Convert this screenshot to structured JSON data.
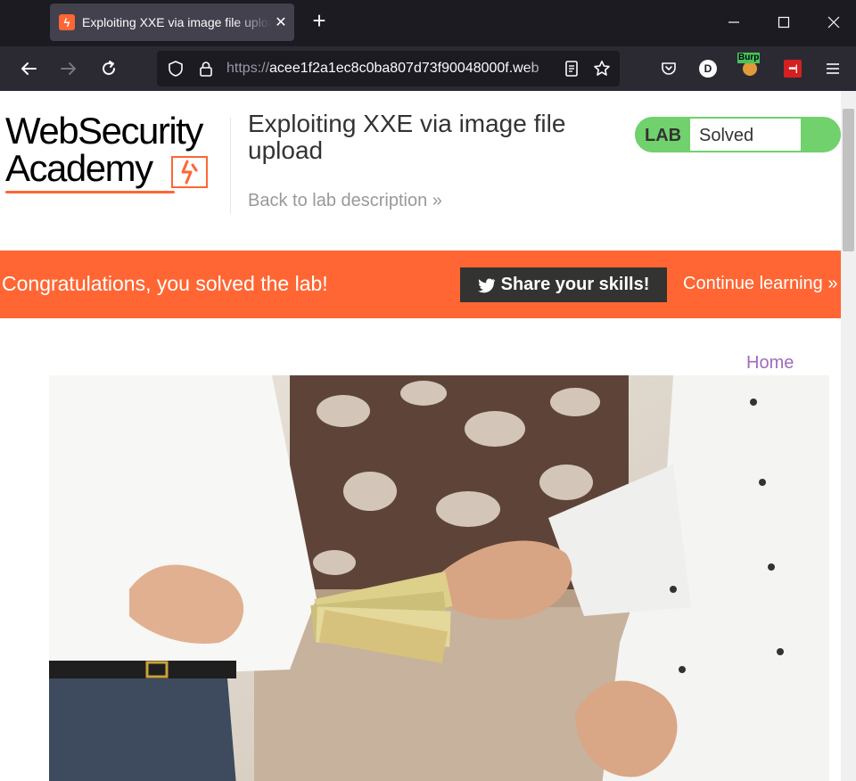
{
  "browser": {
    "tab_title": "Exploiting XXE via image file upload",
    "tab_close": "✕",
    "new_tab": "+",
    "url_host": "acee1f2a1ec8c0ba807d73f90048000f.web",
    "url_scheme": "https://",
    "extensions": {
      "profile_letter": "D",
      "burp_label": "Burp"
    }
  },
  "header": {
    "logo_line1": "WebSecurity",
    "logo_line2": "Academy",
    "lab_title": "Exploiting XXE via image file upload",
    "back_link": "Back to lab description",
    "back_chevrons": "»",
    "status_label": "LAB",
    "status_value": "Solved",
    "status_color": "#70d16d"
  },
  "banner": {
    "message": "Congratulations, you solved the lab!",
    "share_button": "Share your skills!",
    "continue_link": "Continue learning",
    "continue_chevrons": "»",
    "background": "#ff6633"
  },
  "nav": {
    "home": "Home"
  },
  "hero_image": {
    "icon": "hero-photo"
  }
}
